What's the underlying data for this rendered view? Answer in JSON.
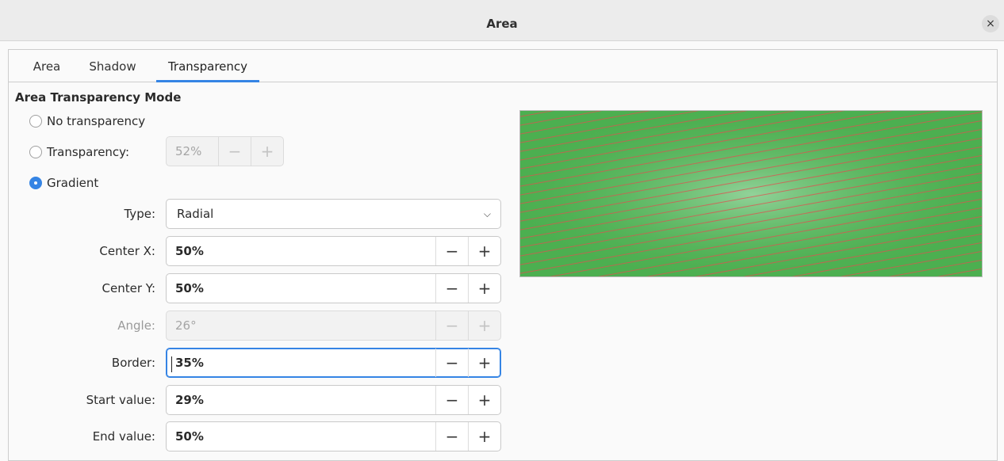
{
  "window": {
    "title": "Area"
  },
  "tabs": [
    {
      "label": "Area",
      "active": false
    },
    {
      "label": "Shadow",
      "active": false
    },
    {
      "label": "Transparency",
      "active": true
    }
  ],
  "section": {
    "title": "Area Transparency Mode"
  },
  "modes": {
    "no_transparency": {
      "label": "No transparency",
      "checked": false
    },
    "transparency": {
      "label": "Transparency:",
      "checked": false,
      "value": "52%"
    },
    "gradient": {
      "label": "Gradient",
      "checked": true
    }
  },
  "gradient": {
    "type": {
      "label": "Type:",
      "value": "Radial"
    },
    "center_x": {
      "label": "Center X:",
      "value": "50%"
    },
    "center_y": {
      "label": "Center Y:",
      "value": "50%"
    },
    "angle": {
      "label": "Angle:",
      "value": "26°",
      "disabled": true
    },
    "border": {
      "label": "Border:",
      "value": "35%",
      "focused": true
    },
    "start_value": {
      "label": "Start value:",
      "value": "29%"
    },
    "end_value": {
      "label": "End value:",
      "value": "50%"
    }
  },
  "buttons": {
    "minus": "−",
    "plus": "+",
    "close": "×",
    "dropdown": "⌵"
  },
  "preview": {
    "fill_color": "#4caf50",
    "highlight_color": "#9ed8a6",
    "hatch_color": "#e05050"
  },
  "colors": {
    "accent": "#3584e4"
  }
}
